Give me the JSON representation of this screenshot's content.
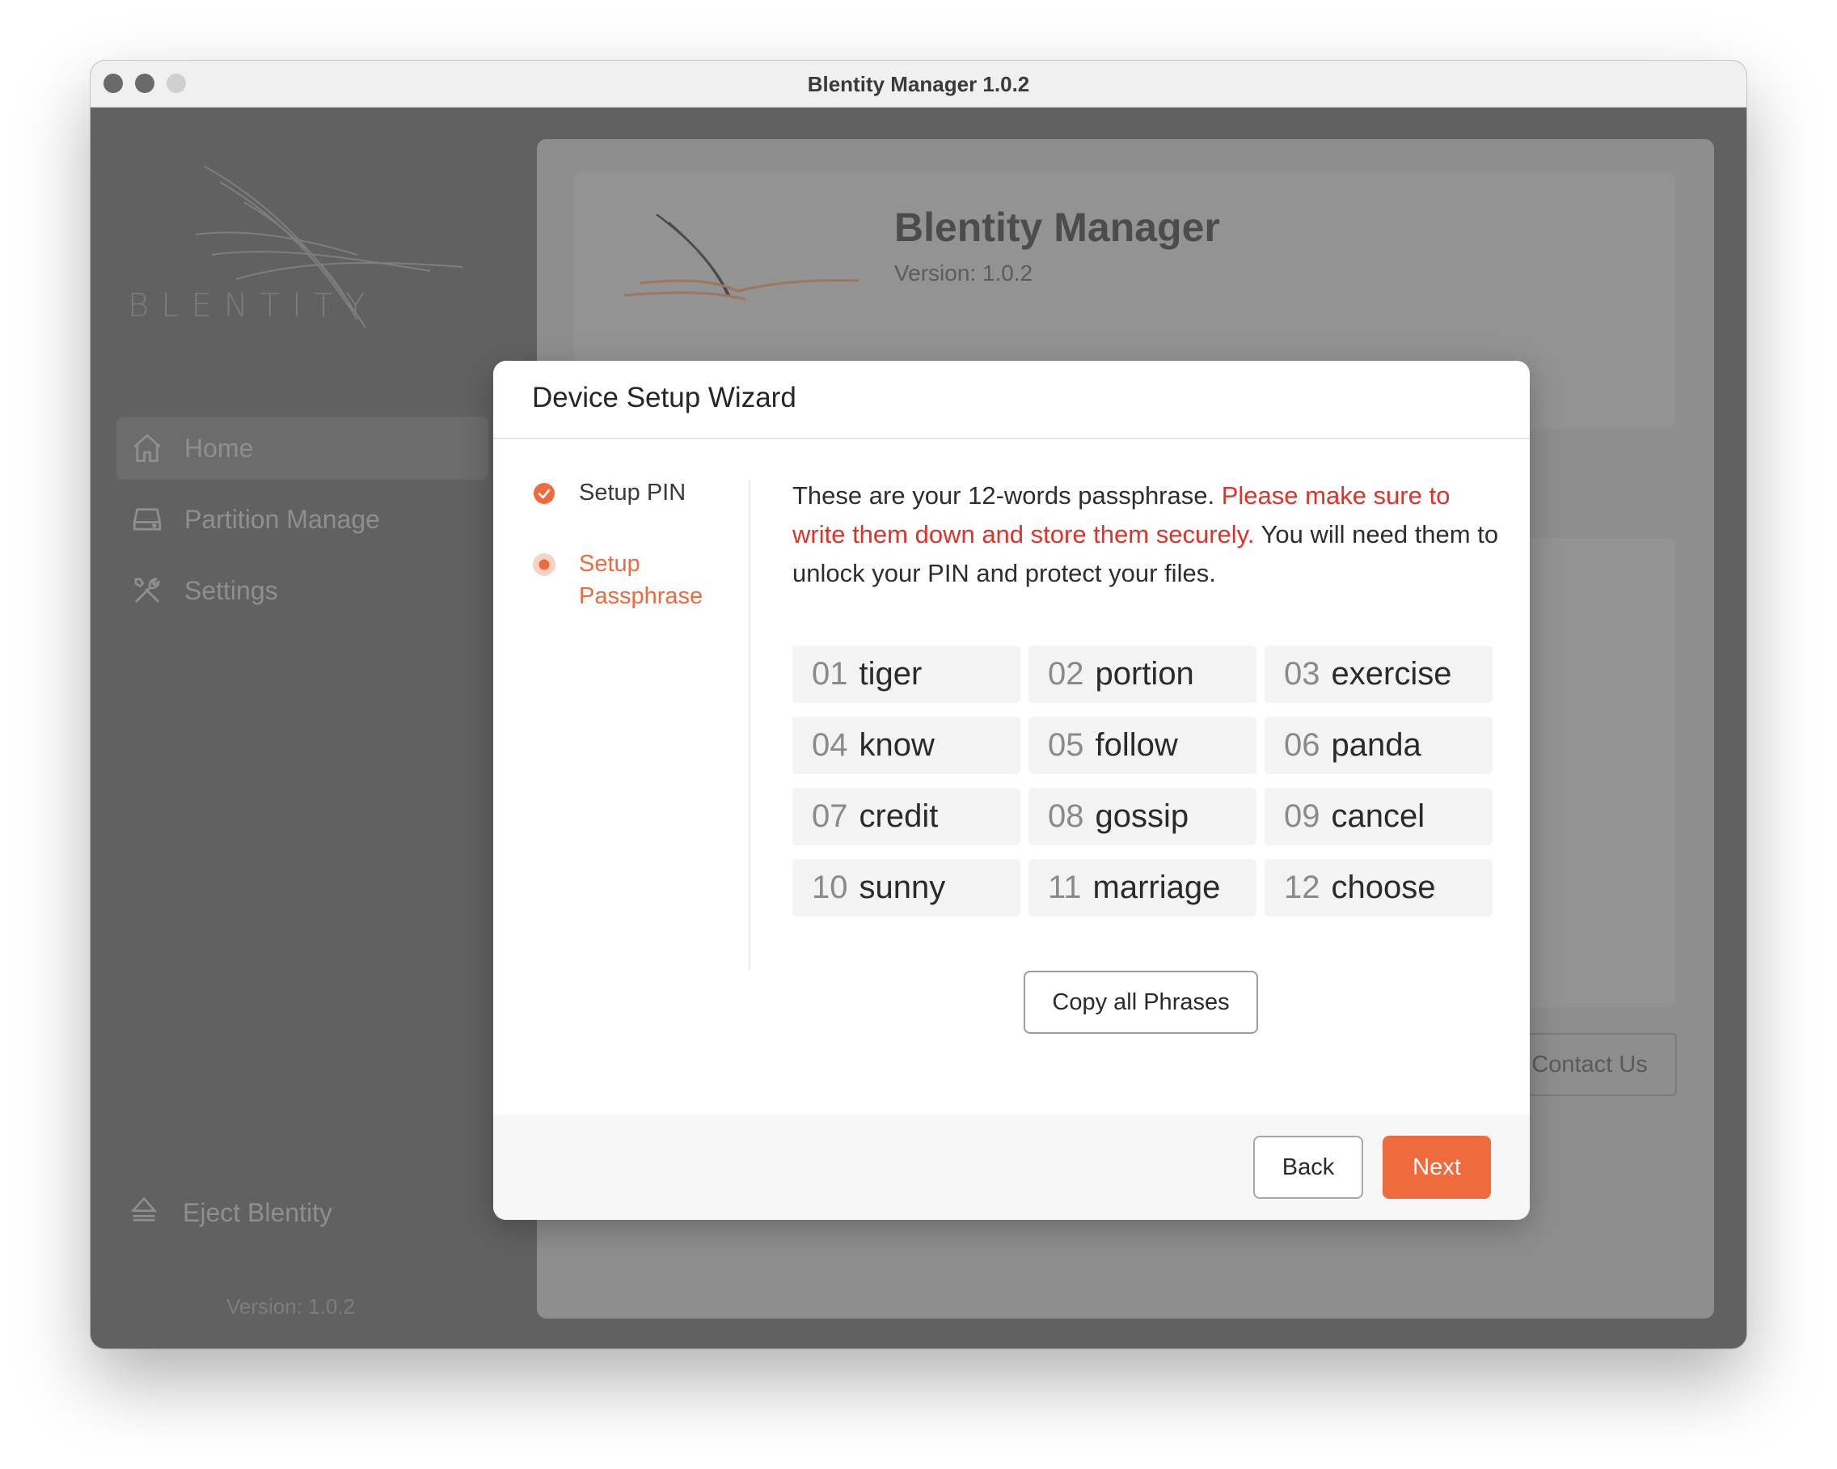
{
  "window": {
    "title": "Blentity Manager 1.0.2"
  },
  "sidebar": {
    "logo_text": "BLENTITY",
    "items": [
      {
        "label": "Home",
        "icon": "home-icon",
        "active": true
      },
      {
        "label": "Partition Manage",
        "icon": "drive-icon",
        "active": false
      },
      {
        "label": "Settings",
        "icon": "tools-icon",
        "active": false
      }
    ],
    "eject_label": "Eject Blentity",
    "version": "Version: 1.0.2"
  },
  "main": {
    "title": "Blentity Manager",
    "version": "Version: 1.0.2",
    "contact_label": "Contact Us"
  },
  "modal": {
    "title": "Device Setup Wizard",
    "steps": [
      {
        "label": "Setup PIN",
        "status": "complete"
      },
      {
        "label": "Setup Passphrase",
        "status": "current"
      }
    ],
    "description_intro": "These are your 12-words passphrase.",
    "description_warning": "Please make sure to write them down and store them securely.",
    "description_outro": "You will need them to unlock your PIN and protect your files.",
    "words": [
      {
        "num": "01",
        "word": "tiger"
      },
      {
        "num": "02",
        "word": "portion"
      },
      {
        "num": "03",
        "word": "exercise"
      },
      {
        "num": "04",
        "word": "know"
      },
      {
        "num": "05",
        "word": "follow"
      },
      {
        "num": "06",
        "word": "panda"
      },
      {
        "num": "07",
        "word": "credit"
      },
      {
        "num": "08",
        "word": "gossip"
      },
      {
        "num": "09",
        "word": "cancel"
      },
      {
        "num": "10",
        "word": "sunny"
      },
      {
        "num": "11",
        "word": "marriage"
      },
      {
        "num": "12",
        "word": "choose"
      }
    ],
    "copy_label": "Copy all Phrases",
    "back_label": "Back",
    "next_label": "Next"
  },
  "colors": {
    "accent": "#ef6b3d",
    "warning": "#e03228"
  }
}
